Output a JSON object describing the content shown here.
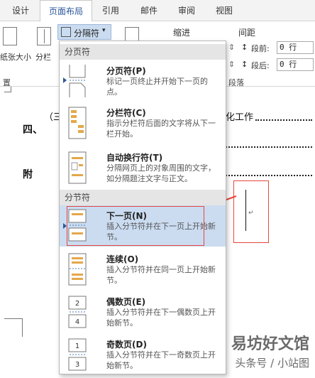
{
  "tabs": [
    "设计",
    "页面布局",
    "引用",
    "邮件",
    "审阅",
    "视图"
  ],
  "ribbon": {
    "paper_size": "纸张大小",
    "columns": "分栏",
    "breaks_button": "分隔符",
    "indent_label": "缩进",
    "spacing_label": "间距",
    "before_label": "段前:",
    "after_label": "段后:",
    "before_value": "0 行",
    "after_value": "0 行",
    "page_setup_group": "置",
    "paragraph_group": "段落"
  },
  "doc": {
    "line1_prefix": "（三",
    "line1_suffix": "化工作",
    "heading4": "四、",
    "appendix": "附"
  },
  "menu": {
    "page_breaks_header": "分页符",
    "section_breaks_header": "分节符",
    "items": [
      {
        "title": "分页符(P)",
        "desc": "标记一页终止并开始下一页的点。"
      },
      {
        "title": "分栏符(C)",
        "desc": "指示分栏符后面的文字将从下一栏开始。"
      },
      {
        "title": "自动换行符(T)",
        "desc": "分隔网页上的对象周围的文字，如分隔题注文字与正文。"
      },
      {
        "title": "下一页(N)",
        "desc": "插入分节符并在下一页上开始新节。"
      },
      {
        "title": "连续(O)",
        "desc": "插入分节符并在同一页上开始新节。"
      },
      {
        "title": "偶数页(E)",
        "desc": "插入分节符并在下一偶数页上开始新节。"
      },
      {
        "title": "奇数页(D)",
        "desc": "插入分节符并在下一奇数页上开始新节。"
      }
    ]
  },
  "watermark": {
    "line1": "易坊好文馆",
    "line2": "头条号 / 小站图"
  },
  "colors": {
    "accent": "#2b579a",
    "highlight": "#cbdcf1",
    "annotation": "#e8453c"
  }
}
